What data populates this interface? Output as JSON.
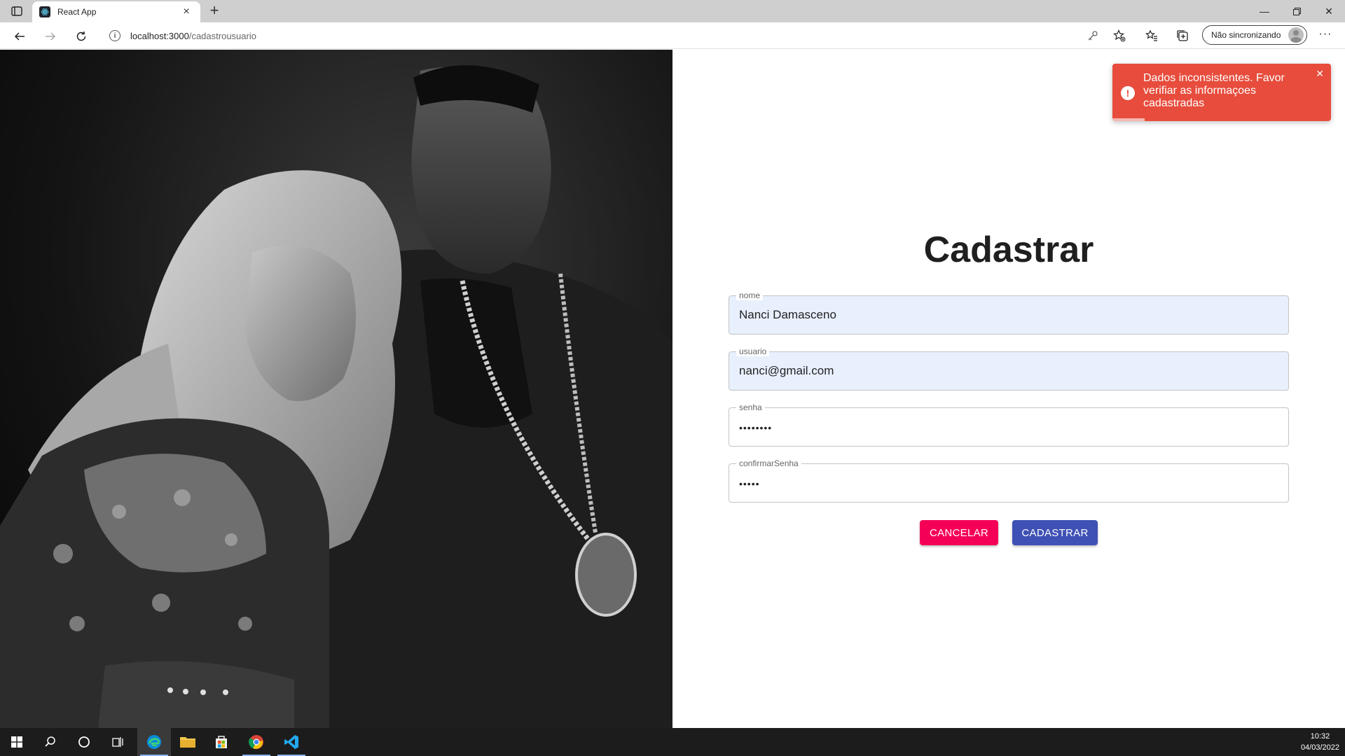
{
  "browser": {
    "tab_title": "React App",
    "url_host": "localhost:3000",
    "url_path": "/cadastrousuario",
    "sync_label": "Não sincronizando"
  },
  "form": {
    "title": "Cadastrar",
    "fields": [
      {
        "label": "nome",
        "value": "Nanci Damasceno",
        "type": "text",
        "autofilled": true
      },
      {
        "label": "usuario",
        "value": "nanci@gmail.com",
        "type": "text",
        "autofilled": true
      },
      {
        "label": "senha",
        "value": "••••••••",
        "type": "password",
        "autofilled": false
      },
      {
        "label": "confirmarSenha",
        "value": "•••••",
        "type": "password",
        "autofilled": false
      }
    ],
    "cancel_label": "CANCELAR",
    "submit_label": "CADASTRAR"
  },
  "toast": {
    "message": "Dados inconsistentes. Favor verifiar as informaçoes cadastradas",
    "icon": "exclamation-circle-icon",
    "close": "✕",
    "color": "#e74c3c"
  },
  "hero": {
    "icon": "couple-photo"
  },
  "taskbar": {
    "time": "10:32",
    "date": "04/03/2022"
  },
  "colors": {
    "cancel": "#f50057",
    "submit": "#3f51b5",
    "autofill": "#e8f0fe"
  }
}
